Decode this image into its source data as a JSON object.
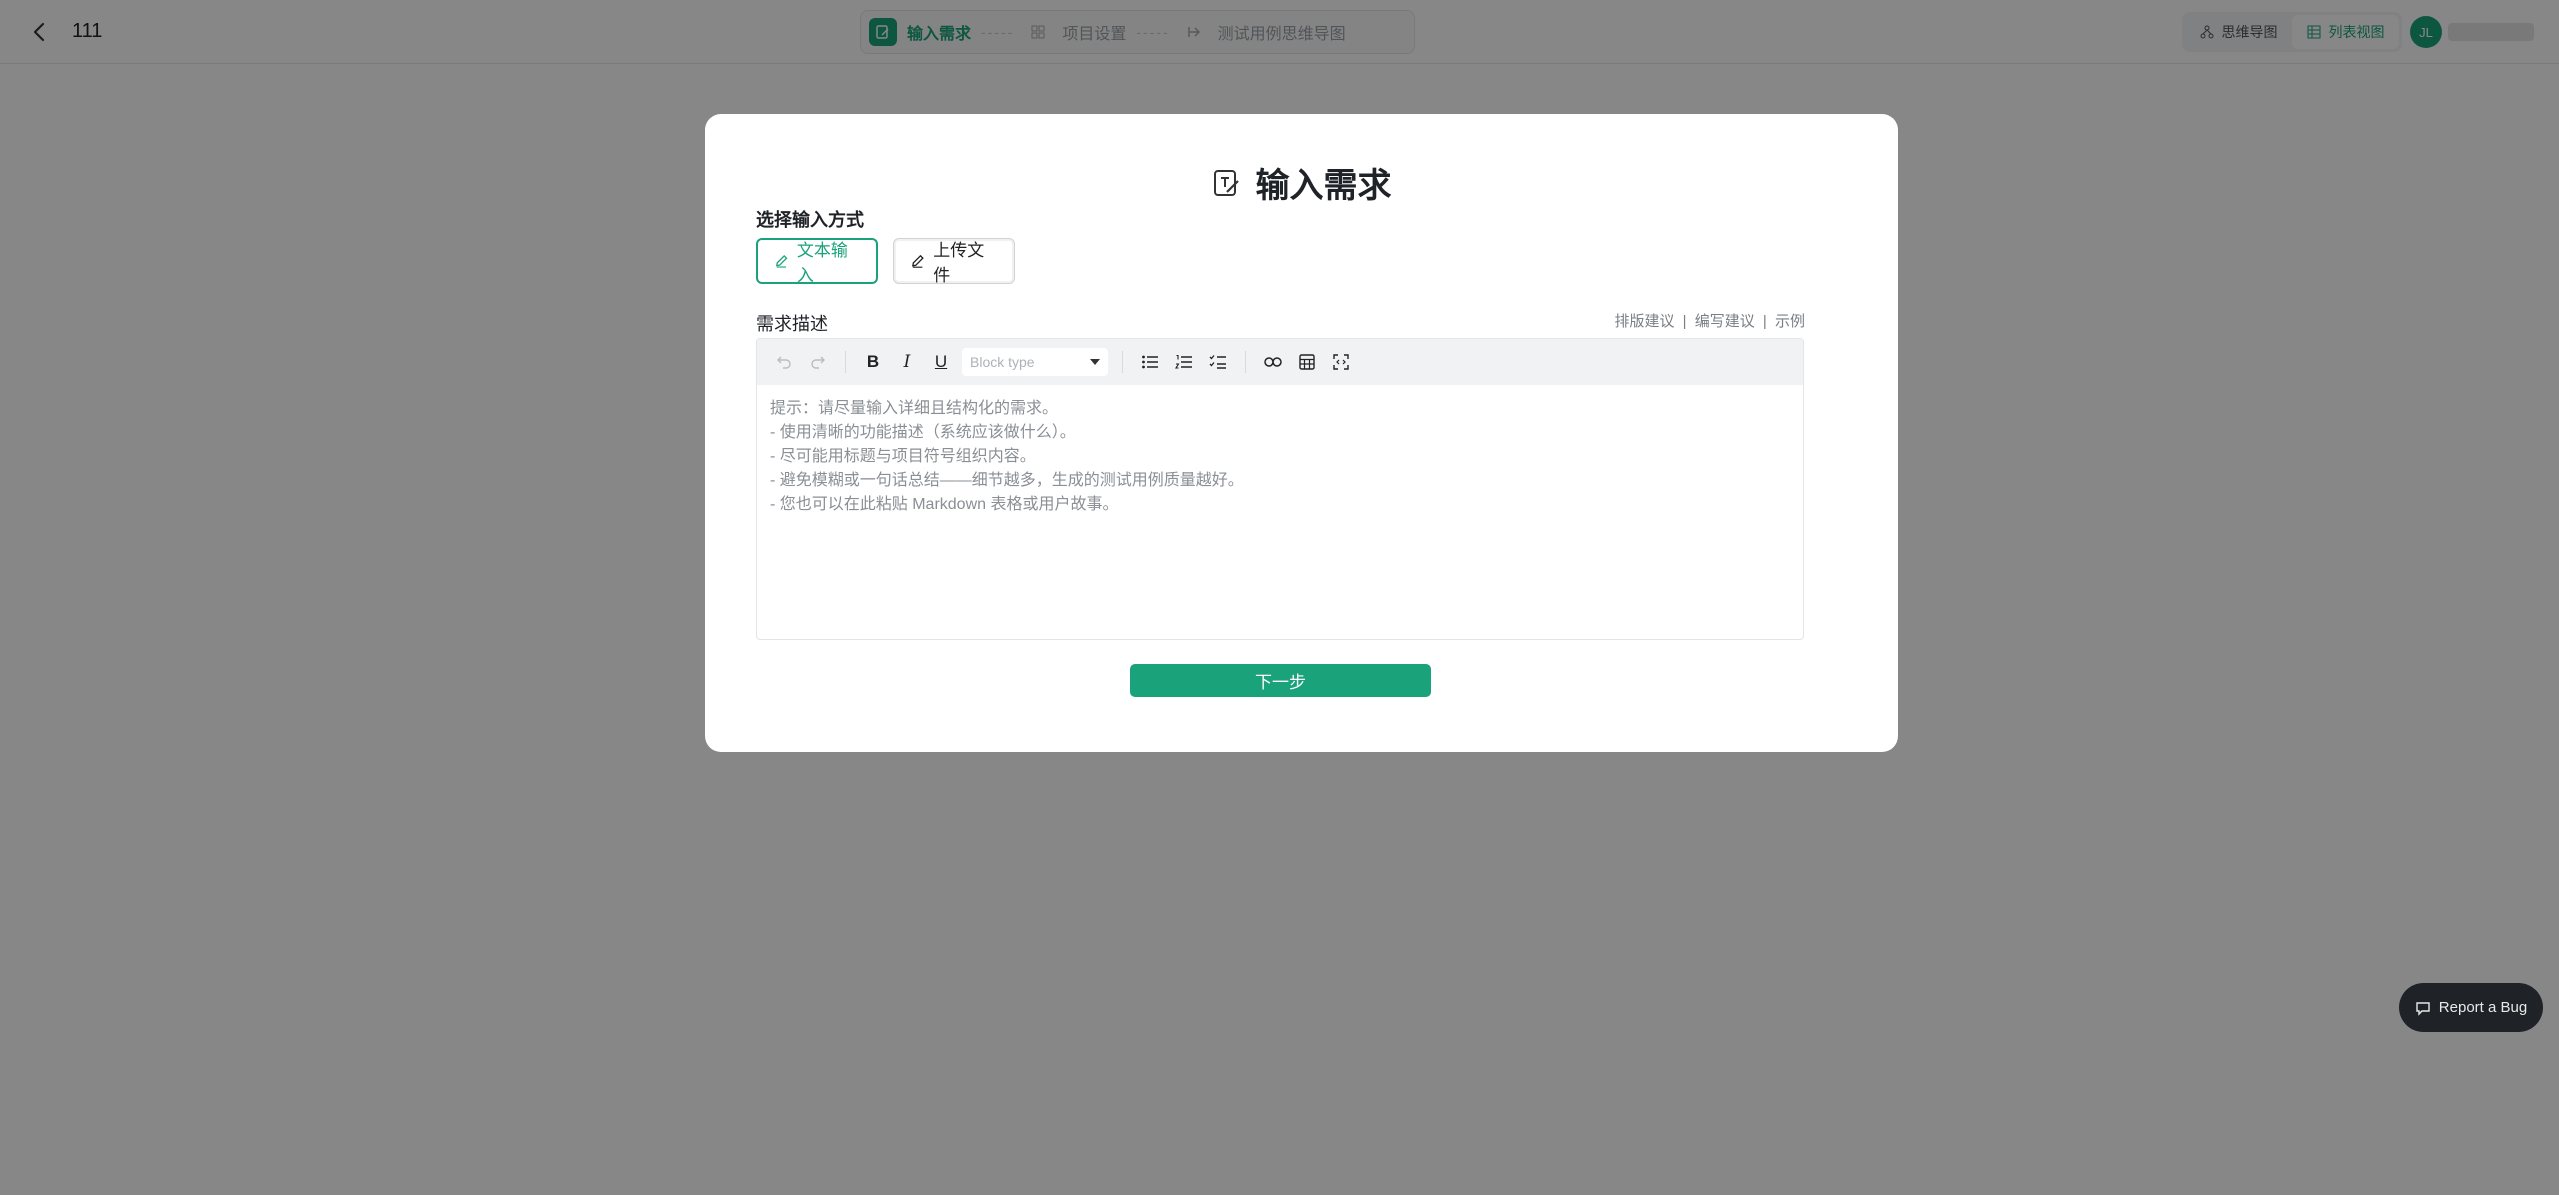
{
  "header": {
    "project_name": "111",
    "steps": [
      {
        "label": "输入需求",
        "icon": "edit-doc-icon",
        "active": true
      },
      {
        "label": "项目设置",
        "icon": "grid-icon",
        "active": false
      },
      {
        "label": "测试用例思维导图",
        "icon": "mindmap-icon",
        "active": false
      }
    ],
    "step_separator": "-----",
    "views": [
      {
        "label": "思维导图",
        "icon": "mindmap-icon",
        "active": false
      },
      {
        "label": "列表视图",
        "icon": "table-icon",
        "active": true
      }
    ],
    "avatar_initials": "JL"
  },
  "modal": {
    "title": "输入需求",
    "input_mode_label": "选择输入方式",
    "modes": [
      {
        "label": "文本输入",
        "icon": "pencil-icon",
        "selected": true
      },
      {
        "label": "上传文件",
        "icon": "pencil-icon",
        "selected": false
      }
    ],
    "description_label": "需求描述",
    "hint_links": [
      "排版建议",
      "编写建议",
      "示例"
    ],
    "hint_separator": "|",
    "toolbar": {
      "block_type_placeholder": "Block type"
    },
    "editor_placeholder_lines": [
      "提示：请尽量输入详细且结构化的需求。",
      "- 使用清晰的功能描述（系统应该做什么）。",
      "- 尽可能用标题与项目符号组织内容。",
      "- 避免模糊或一句话总结——细节越多，生成的测试用例质量越好。",
      "- 您也可以在此粘贴 Markdown 表格或用户故事。"
    ],
    "next_label": "下一步"
  },
  "report_bug": {
    "label": "Report a Bug",
    "icon": "chat-bug-icon"
  },
  "colors": {
    "accent": "#1aa37a",
    "overlay": "rgba(0,0,0,0.47)"
  }
}
